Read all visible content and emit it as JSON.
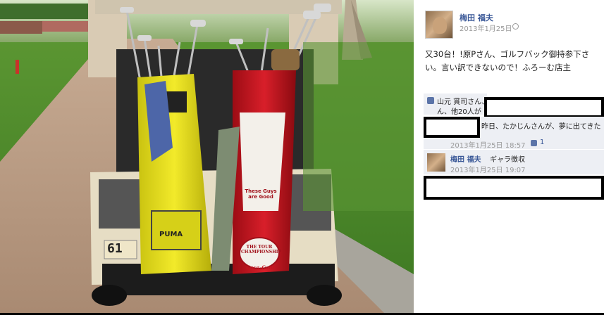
{
  "post": {
    "author": "梅田 福夫",
    "timestamp": "2013年1月25日",
    "privacy_icon": "globe-icon",
    "text": "又30台！!原Pさん、ゴルフバック御持参下さい。言い訳できないので！ふろーむ店主"
  },
  "likes": {
    "icon": "thumbs-up-icon",
    "line1": "山元 貫司さん、",
    "line2": "ん、他20人が"
  },
  "comments": [
    {
      "text": "昨日、たかじんさんが、夢に出てきた",
      "timestamp": "2013年1月25日 18:57",
      "like_count": "1"
    },
    {
      "author": "梅田 福夫",
      "text": "ギャラ徴収",
      "timestamp": "2013年1月25日 19:07"
    }
  ],
  "photo": {
    "cart_number": "61",
    "bag_brand": "PUMA",
    "tag_text": "These Guys are Good",
    "tour_text": "THE TOUR CHAMPIONSHIP",
    "sponsor_text": "Coca-Cola"
  },
  "colors": {
    "link_blue": "#3b5998",
    "meta_gray": "#999999",
    "grass_green": "#4f8a2e",
    "path_tan": "#b8a08a"
  }
}
